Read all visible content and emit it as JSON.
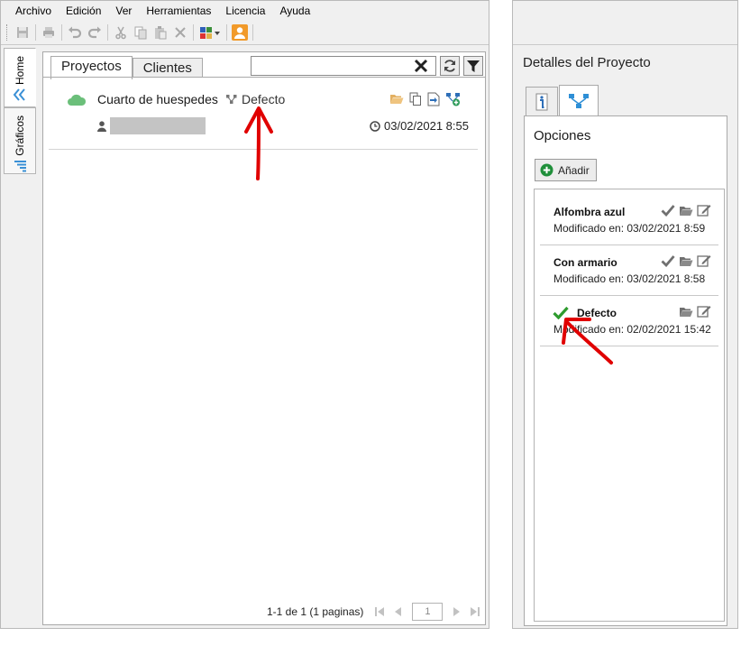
{
  "menu": [
    "Archivo",
    "Edición",
    "Ver",
    "Herramientas",
    "Licencia",
    "Ayuda"
  ],
  "sidebar": {
    "home_label": "Home",
    "graphs_label": "Gráficos"
  },
  "tabs": {
    "projects": "Proyectos",
    "clients": "Clientes"
  },
  "search": {
    "value": "",
    "placeholder": ""
  },
  "project": {
    "name": "Cuarto de huespedes",
    "variant": "Defecto",
    "date": "03/02/2021 8:55"
  },
  "pager": {
    "summary": "1-1 de 1 (1 paginas)",
    "page": "1"
  },
  "details": {
    "title": "Detalles del Proyecto",
    "section": "Opciones",
    "add_label": "Añadir",
    "options": [
      {
        "name": "Alfombra azul",
        "modified": "Modificado en: 03/02/2021 8:59",
        "active": false
      },
      {
        "name": "Con armario",
        "modified": "Modificado en: 03/02/2021 8:58",
        "active": false
      },
      {
        "name": "Defecto",
        "modified": "Modificado en: 02/02/2021 15:42",
        "active": true
      }
    ]
  },
  "colors": {
    "annotation_arrow": "#e00000",
    "cloud": "#6bbf7a",
    "check_active": "#2e9b2e",
    "folder": "#e3b062"
  }
}
